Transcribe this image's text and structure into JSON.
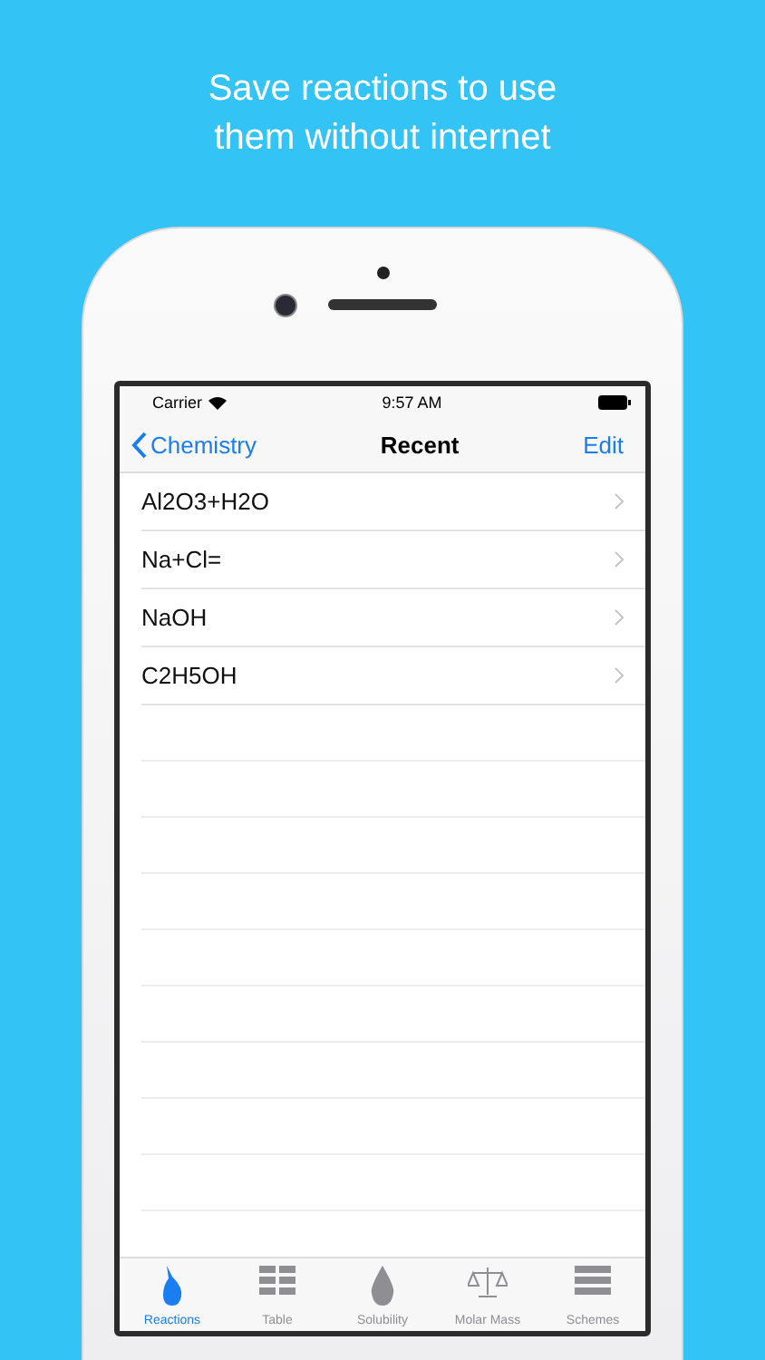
{
  "headline": [
    "Save reactions to use",
    "them without internet"
  ],
  "status_bar": {
    "carrier": "Carrier",
    "time": "9:57 AM"
  },
  "nav": {
    "back": "Chemistry",
    "title": "Recent",
    "action": "Edit"
  },
  "rows": [
    {
      "label": "Al2O3+H2O"
    },
    {
      "label": "Na+Cl="
    },
    {
      "label": "NaOH"
    },
    {
      "label": "C2H5OH"
    }
  ],
  "tabs": [
    {
      "label": "Reactions",
      "kind": "flame",
      "selected": true
    },
    {
      "label": "Table",
      "kind": "grid",
      "selected": false
    },
    {
      "label": "Solubility",
      "kind": "drop",
      "selected": false
    },
    {
      "label": "Molar Mass",
      "kind": "scale",
      "selected": false
    },
    {
      "label": "Schemes",
      "kind": "bars",
      "selected": false
    }
  ]
}
